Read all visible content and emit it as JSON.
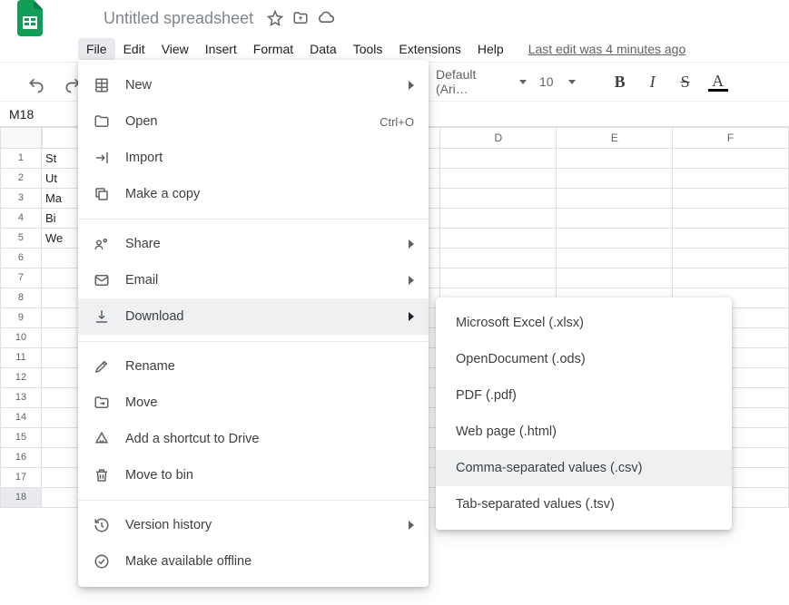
{
  "doc": {
    "title": "Untitled spreadsheet"
  },
  "menubar": {
    "items": [
      "File",
      "Edit",
      "View",
      "Insert",
      "Format",
      "Data",
      "Tools",
      "Extensions",
      "Help"
    ],
    "last_edit": "Last edit was 4 minutes ago"
  },
  "toolbar": {
    "font": "Default (Ari…",
    "font_size": "10"
  },
  "cell_ref": "M18",
  "columns": [
    "D",
    "E",
    "F"
  ],
  "rows": [
    {
      "n": "1",
      "a": "St"
    },
    {
      "n": "2",
      "a": "Ut"
    },
    {
      "n": "3",
      "a": "Ma"
    },
    {
      "n": "4",
      "a": "Bi"
    },
    {
      "n": "5",
      "a": "We"
    },
    {
      "n": "6",
      "a": ""
    },
    {
      "n": "7",
      "a": ""
    },
    {
      "n": "8",
      "a": ""
    },
    {
      "n": "9",
      "a": ""
    },
    {
      "n": "10",
      "a": ""
    },
    {
      "n": "11",
      "a": ""
    },
    {
      "n": "12",
      "a": ""
    },
    {
      "n": "13",
      "a": ""
    },
    {
      "n": "14",
      "a": ""
    },
    {
      "n": "15",
      "a": ""
    },
    {
      "n": "16",
      "a": ""
    },
    {
      "n": "17",
      "a": ""
    },
    {
      "n": "18",
      "a": ""
    }
  ],
  "file_menu": {
    "new": "New",
    "open": "Open",
    "open_accel": "Ctrl+O",
    "import": "Import",
    "copy": "Make a copy",
    "share": "Share",
    "email": "Email",
    "download": "Download",
    "rename": "Rename",
    "move": "Move",
    "shortcut": "Add a shortcut to Drive",
    "trash": "Move to bin",
    "version": "Version history",
    "offline": "Make available offline"
  },
  "download_submenu": {
    "xlsx": "Microsoft Excel (.xlsx)",
    "ods": "OpenDocument (.ods)",
    "pdf": "PDF (.pdf)",
    "html": "Web page (.html)",
    "csv": "Comma-separated values (.csv)",
    "tsv": "Tab-separated values (.tsv)"
  }
}
